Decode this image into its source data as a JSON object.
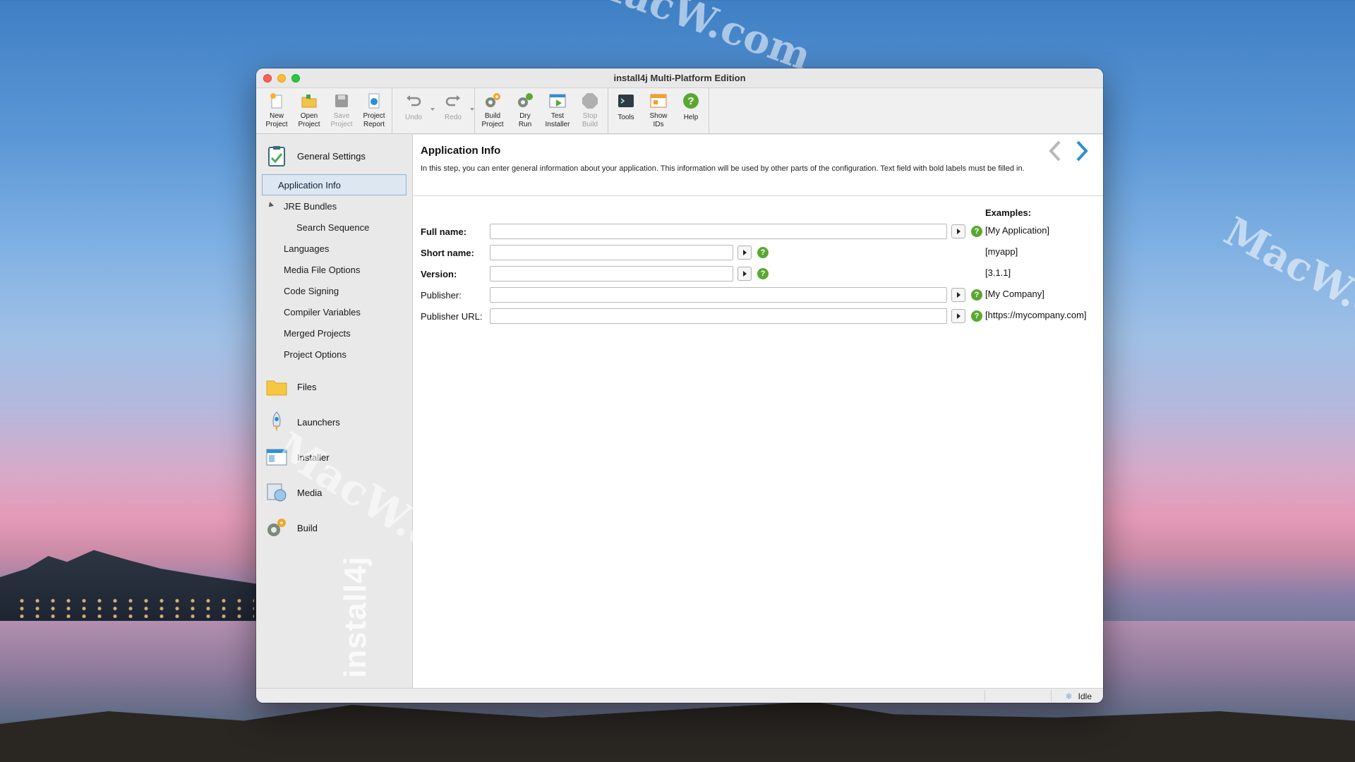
{
  "window": {
    "title": "install4j Multi-Platform Edition"
  },
  "toolbar": {
    "new_project": "New\nProject",
    "open_project": "Open\nProject",
    "save_project": "Save\nProject",
    "project_report": "Project\nReport",
    "undo": "Undo",
    "redo": "Redo",
    "build_project": "Build\nProject",
    "dry_run": "Dry\nRun",
    "test_installer": "Test\nInstaller",
    "stop_build": "Stop\nBuild",
    "tools": "Tools",
    "show_ids": "Show\nIDs",
    "help": "Help"
  },
  "sidebar": {
    "general_settings": "General Settings",
    "items": [
      "Application Info",
      "JRE Bundles",
      "Search Sequence",
      "Languages",
      "Media File Options",
      "Code Signing",
      "Compiler Variables",
      "Merged Projects",
      "Project Options"
    ],
    "sections": [
      "Files",
      "Launchers",
      "Installer",
      "Media",
      "Build"
    ],
    "watermark": "install4j"
  },
  "content": {
    "title": "Application Info",
    "description": "In this step, you can enter general information about your application. This information will be used by other parts of the configuration. Text field with bold labels must be filled in.",
    "examples_title": "Examples:",
    "fields": [
      {
        "label": "Full name:",
        "value": "",
        "example": "[My Application]"
      },
      {
        "label": "Short name:",
        "value": "",
        "example": "[myapp]"
      },
      {
        "label": "Version:",
        "value": "",
        "example": "[3.1.1]"
      },
      {
        "label": "Publisher:",
        "value": "",
        "example": "[My Company]"
      },
      {
        "label": "Publisher URL:",
        "value": "",
        "example": "[https://mycompany.com]"
      }
    ]
  },
  "status": {
    "text": "Idle"
  },
  "watermarks": {
    "mark1": "MacW.com",
    "mark2": "MacW.com",
    "mark3": "MacW.com"
  }
}
